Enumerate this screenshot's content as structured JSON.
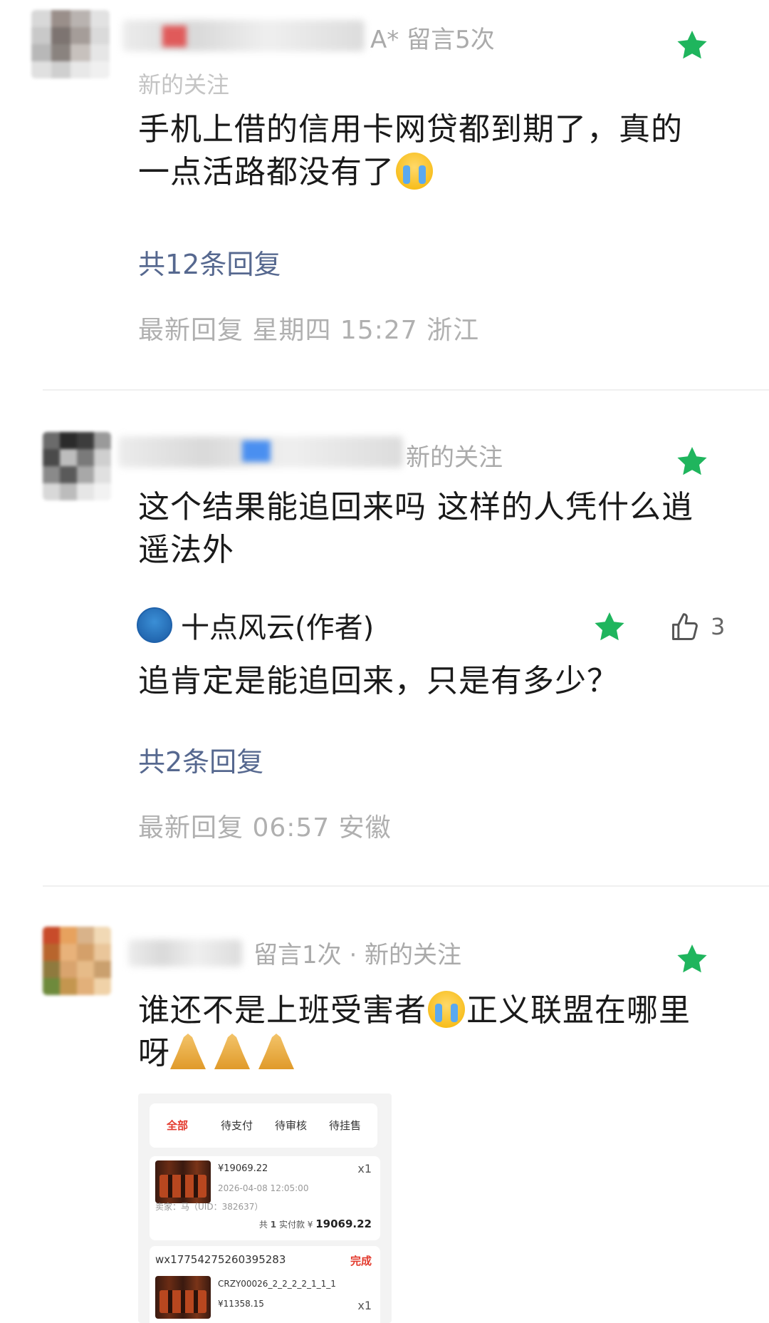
{
  "comments": [
    {
      "meta_suffix": "A* 留言5次",
      "meta_line2": "新的关注",
      "text_line1": "手机上借的信用卡网贷都到期了，真的",
      "text_line2": "一点活路都没有了",
      "reply_count": "共12条回复",
      "latest_reply": "最新回复 星期四  15:27  浙江"
    },
    {
      "meta_suffix": "新的关注",
      "text_line1": "这个结果能追回来吗 这样的人凭什么逍",
      "text_line2": "遥法外",
      "author_reply": {
        "author": "十点风云(作者)",
        "like_count": "3",
        "text": "追肯定是能追回来，只是有多少？"
      },
      "reply_count": "共2条回复",
      "latest_reply": "最新回复 06:57  安徽"
    },
    {
      "name_partial": "Snow li",
      "meta_suffix": "留言1次 · 新的关注",
      "text_line1a": "谁还不是上班受害者",
      "text_line1b": "正义联盟在哪里",
      "text_line2": "呀"
    }
  ],
  "screenshot": {
    "tabs": [
      "全部",
      "待支付",
      "待审核",
      "待挂售"
    ],
    "order1": {
      "price": "¥19069.22",
      "qty": "x1",
      "time": "2026-04-08 12:05:00",
      "seller": "卖家：马（UID：382637）",
      "total_prefix": "共",
      "total_count": "1",
      "total_label": "实付款 ¥",
      "total_value": "19069.22"
    },
    "order2": {
      "order_no": "wx17754275260395283",
      "status": "完成",
      "code": "CRZY00026_2_2_2_2_1_1_1",
      "price": "¥11358.15",
      "qty": "x1"
    }
  },
  "colors": {
    "star": "#1fb55d",
    "reply_link": "#56688f",
    "meta_gray": "#b3b3b3",
    "active_tab": "#e33b2e"
  }
}
